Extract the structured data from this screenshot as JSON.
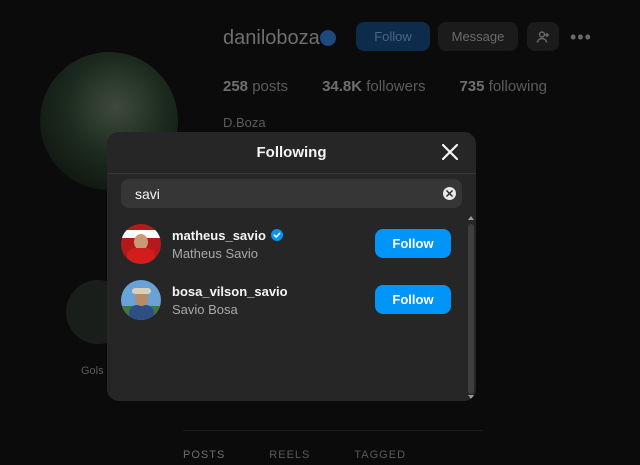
{
  "profile": {
    "username": "daniloboza",
    "follow_label": "Follow",
    "message_label": "Message",
    "more_label": "•••",
    "posts": "258",
    "posts_label": "posts",
    "followers": "34.8K",
    "followers_label": "followers",
    "following": "735",
    "following_label": "following",
    "full_name": "D.Boza",
    "highlight_label": "Gols",
    "tabs": [
      "POSTS",
      "REELS",
      "TAGGED"
    ]
  },
  "modal": {
    "title": "Following",
    "search": {
      "value": "savi",
      "placeholder": "Search"
    },
    "results": [
      {
        "username": "matheus_savio",
        "full_name": "Matheus Savio",
        "verified": true,
        "button_label": "Follow"
      },
      {
        "username": "bosa_vilson_savio",
        "full_name": "Savio Bosa",
        "verified": false,
        "button_label": "Follow"
      }
    ]
  },
  "colors": {
    "accent": "#0095f6",
    "modal_bg": "#262626",
    "page_bg": "#000000"
  }
}
